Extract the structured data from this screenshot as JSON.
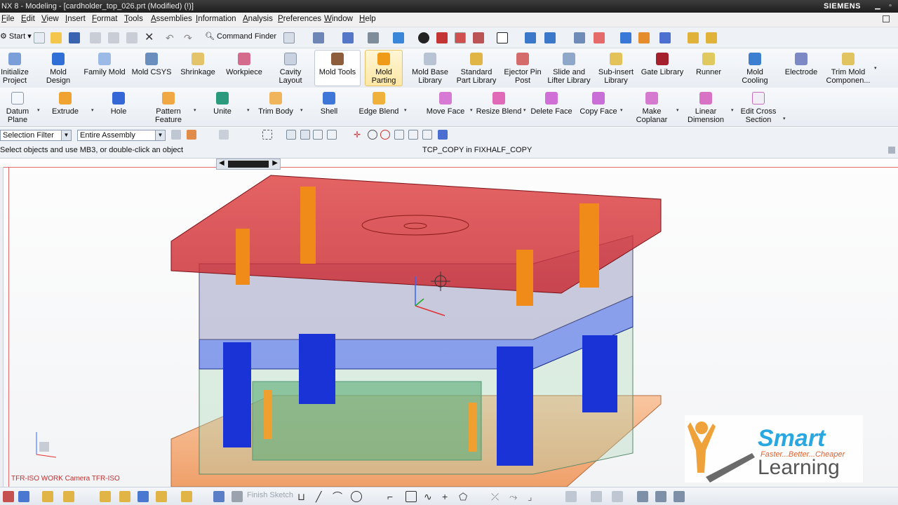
{
  "window": {
    "title": "NX 8 - Modeling - [cardholder_top_026.prt (Modified)   (!)]",
    "brand": "SIEMENS"
  },
  "menu": [
    "File",
    "Edit",
    "View",
    "Insert",
    "Format",
    "Tools",
    "Assemblies",
    "Information",
    "Analysis",
    "Preferences",
    "Window",
    "Help"
  ],
  "toolbar": {
    "start_label": "Start",
    "command_finder_label": "Command Finder"
  },
  "ribbon_row1": [
    {
      "label": "Initialize\nProject",
      "icon": "initialize-project-icon"
    },
    {
      "label": "Mold\nDesign",
      "icon": "mold-design-icon"
    },
    {
      "label": "Family Mold",
      "icon": "family-mold-icon"
    },
    {
      "label": "Mold CSYS",
      "icon": "mold-csys-icon"
    },
    {
      "label": "Shrinkage",
      "icon": "shrinkage-icon"
    },
    {
      "label": "Workpiece",
      "icon": "workpiece-icon"
    },
    {
      "label": "Cavity\nLayout",
      "icon": "cavity-layout-icon"
    },
    {
      "label": "Mold Tools",
      "icon": "mold-tools-icon"
    },
    {
      "label": "Mold\nParting",
      "icon": "mold-parting-icon"
    },
    {
      "label": "Mold Base\nLibrary",
      "icon": "mold-base-library-icon"
    },
    {
      "label": "Standard\nPart Library",
      "icon": "standard-part-library-icon"
    },
    {
      "label": "Ejector Pin\nPost",
      "icon": "ejector-pin-post-icon"
    },
    {
      "label": "Slide and\nLifter Library",
      "icon": "slide-lifter-library-icon"
    },
    {
      "label": "Sub-insert\nLibrary",
      "icon": "sub-insert-library-icon"
    },
    {
      "label": "Gate Library",
      "icon": "gate-library-icon"
    },
    {
      "label": "Runner",
      "icon": "runner-icon"
    },
    {
      "label": "Mold\nCooling",
      "icon": "mold-cooling-icon"
    },
    {
      "label": "Electrode",
      "icon": "electrode-icon"
    },
    {
      "label": "Trim Mold\nComponen...",
      "icon": "trim-mold-components-icon"
    }
  ],
  "ribbon_row2": [
    {
      "label": "Datum Plane",
      "icon": "datum-plane-icon"
    },
    {
      "label": "Extrude",
      "icon": "extrude-icon"
    },
    {
      "label": "Hole",
      "icon": "hole-icon"
    },
    {
      "label": "Pattern\nFeature",
      "icon": "pattern-feature-icon"
    },
    {
      "label": "Unite",
      "icon": "unite-icon"
    },
    {
      "label": "Trim Body",
      "icon": "trim-body-icon"
    },
    {
      "label": "Shell",
      "icon": "shell-icon"
    },
    {
      "label": "Edge Blend",
      "icon": "edge-blend-icon"
    },
    {
      "label": "Move Face",
      "icon": "move-face-icon"
    },
    {
      "label": "Resize Blend",
      "icon": "resize-blend-icon"
    },
    {
      "label": "Delete Face",
      "icon": "delete-face-icon"
    },
    {
      "label": "Copy Face",
      "icon": "copy-face-icon"
    },
    {
      "label": "Make\nCoplanar",
      "icon": "make-coplanar-icon"
    },
    {
      "label": "Linear\nDimension",
      "icon": "linear-dimension-icon"
    },
    {
      "label": "Edit Cross\nSection",
      "icon": "edit-cross-section-icon"
    }
  ],
  "filters": {
    "selection_filter": "Selection Filter",
    "scope": "Entire Assembly"
  },
  "status": {
    "prompt": "Select objects and use MB3, or double-click an object",
    "context": "TCP_COPY in FIXHALF_COPY"
  },
  "viewport": {
    "view_label": "TFR-ISO WORK Camera TFR-ISO"
  },
  "watermark": {
    "brand": "Smart",
    "tagline": "Faster...Better...Cheaper",
    "word": "Learning"
  },
  "bottom_toolbar": {
    "finish_sketch_label": "Finish Sketch"
  },
  "colors": {
    "plate_top": "#d6242a",
    "plate_blue": "#1f3fd8",
    "plate_green": "#2e9a57",
    "plate_base": "#f2a065",
    "pin_orange": "#f08a18"
  }
}
